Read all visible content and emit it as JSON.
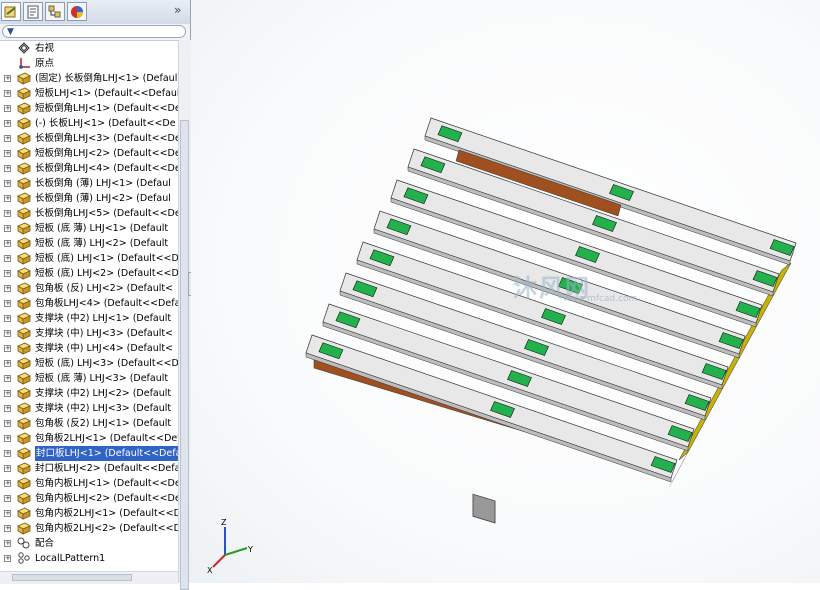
{
  "feature_manager": {
    "tabs": [
      {
        "name": "feature-tree-tab"
      },
      {
        "name": "property-tab"
      },
      {
        "name": "configuration-tab"
      },
      {
        "name": "display-tab"
      }
    ],
    "expand_label": "»",
    "filter_icon": "▼",
    "items": [
      {
        "label": "右视",
        "icon": "plane",
        "expand": false
      },
      {
        "label": "原点",
        "icon": "origin",
        "expand": false
      },
      {
        "label": "(固定) 长板倒角LHJ<1> (Defaul",
        "icon": "part",
        "expand": true
      },
      {
        "label": "短板LHJ<1> (Default<<Default",
        "icon": "part",
        "expand": true
      },
      {
        "label": "短板倒角LHJ<1> (Default<<Def",
        "icon": "part",
        "expand": true
      },
      {
        "label": "(-) 长板LHJ<1> (Default<<De",
        "icon": "part",
        "expand": true
      },
      {
        "label": "长板倒角LHJ<3> (Default<<Def",
        "icon": "part",
        "expand": true
      },
      {
        "label": "短板倒角LHJ<2> (Default<<Def",
        "icon": "part",
        "expand": true
      },
      {
        "label": "长板倒角LHJ<4> (Default<<Def",
        "icon": "part",
        "expand": true
      },
      {
        "label": "长板倒角 (薄) LHJ<1> (Defaul",
        "icon": "part",
        "expand": true
      },
      {
        "label": "长板倒角 (薄) LHJ<2> (Defaul",
        "icon": "part",
        "expand": true
      },
      {
        "label": "长板倒角LHJ<5> (Default<<Def",
        "icon": "part",
        "expand": true
      },
      {
        "label": "短板 (底 薄) LHJ<1> (Default",
        "icon": "part",
        "expand": true
      },
      {
        "label": "短板 (底 薄) LHJ<2> (Default",
        "icon": "part",
        "expand": true
      },
      {
        "label": "短板 (底) LHJ<1> (Default<<D",
        "icon": "part",
        "expand": true
      },
      {
        "label": "短板 (底) LHJ<2> (Default<<D",
        "icon": "part",
        "expand": true
      },
      {
        "label": "包角板 (反) LHJ<2> (Default<",
        "icon": "part",
        "expand": true
      },
      {
        "label": "包角板LHJ<4> (Default<<Defau",
        "icon": "part",
        "expand": true
      },
      {
        "label": "支撑块 (中2) LHJ<1> (Default",
        "icon": "part",
        "expand": true
      },
      {
        "label": "支撑块 (中) LHJ<3> (Default<",
        "icon": "part",
        "expand": true
      },
      {
        "label": "支撑块 (中) LHJ<4> (Default<",
        "icon": "part",
        "expand": true
      },
      {
        "label": "短板 (底) LHJ<3> (Default<<D",
        "icon": "part",
        "expand": true
      },
      {
        "label": "短板 (底 薄) LHJ<3> (Default",
        "icon": "part",
        "expand": true
      },
      {
        "label": "支撑块 (中2) LHJ<2> (Default",
        "icon": "part",
        "expand": true
      },
      {
        "label": "支撑块 (中2) LHJ<3> (Default",
        "icon": "part",
        "expand": true
      },
      {
        "label": "包角板 (反2) LHJ<1> (Default",
        "icon": "part",
        "expand": true
      },
      {
        "label": "包角板2LHJ<1> (Default<<Defa",
        "icon": "part",
        "expand": true
      },
      {
        "label": "封口板LHJ<1> (Default<<Defau",
        "icon": "part",
        "expand": true,
        "selected": true
      },
      {
        "label": "封口板LHJ<2> (Default<<Defau",
        "icon": "part",
        "expand": true
      },
      {
        "label": "包角内板LHJ<1> (Default<<Def",
        "icon": "part",
        "expand": true
      },
      {
        "label": "包角内板LHJ<2> (Default<<Def",
        "icon": "part",
        "expand": true
      },
      {
        "label": "包角内板2LHJ<1> (Default<<De",
        "icon": "part",
        "expand": true
      },
      {
        "label": "包角内板2LHJ<2> (Default<<De",
        "icon": "part",
        "expand": true
      },
      {
        "label": "配合",
        "icon": "mates",
        "expand": true
      },
      {
        "label": "LocalLPattern1",
        "icon": "pattern",
        "expand": true
      }
    ]
  },
  "viewport": {
    "watermark": "沐风网",
    "watermark_url": "www.mfcad.com",
    "triad": {
      "x": "X",
      "y": "Y",
      "z": "Z"
    },
    "colors": {
      "board": "#e8e8e8",
      "block_green": "#22b14c",
      "side_brown": "#a0501e",
      "side_yellow": "#c8b400",
      "selection": "#3163c5"
    }
  }
}
